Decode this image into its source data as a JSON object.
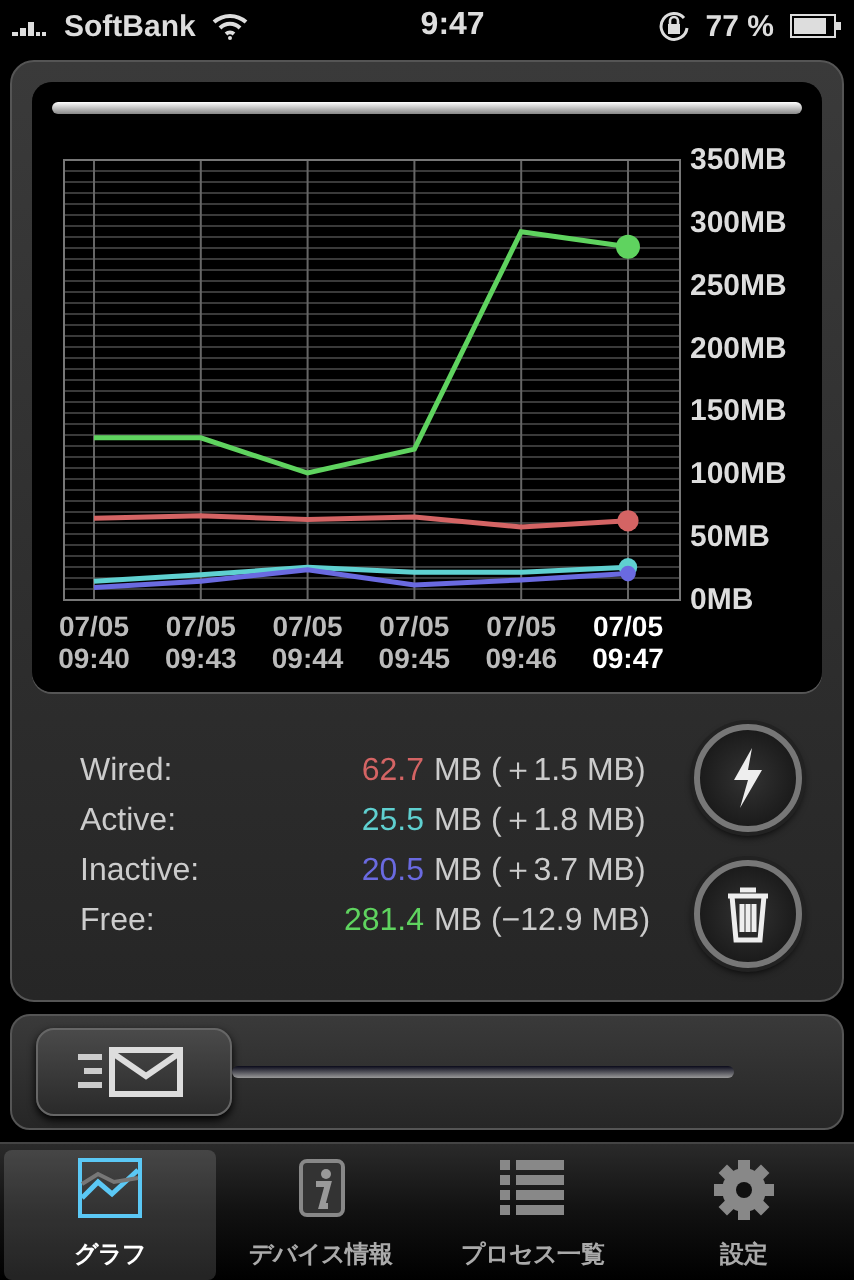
{
  "status_bar": {
    "carrier": "SoftBank",
    "time": "9:47",
    "battery": "77 %"
  },
  "graph": {
    "chart_data": {
      "type": "line",
      "grid": true,
      "categories": [
        "07/05 09:40",
        "07/05 09:43",
        "07/05 09:44",
        "07/05 09:45",
        "07/05 09:46",
        "07/05 09:47"
      ],
      "ylim": [
        0,
        350
      ],
      "yticks": [
        {
          "value": 0,
          "label": "0MB"
        },
        {
          "value": 50,
          "label": "50MB"
        },
        {
          "value": 100,
          "label": "100MB"
        },
        {
          "value": 150,
          "label": "150MB"
        },
        {
          "value": 200,
          "label": "200MB"
        },
        {
          "value": 250,
          "label": "250MB"
        },
        {
          "value": 300,
          "label": "300MB"
        },
        {
          "value": 350,
          "label": "350MB"
        }
      ],
      "series": [
        {
          "color": "#5fd35f",
          "values": [
            129,
            129,
            101,
            120,
            293,
            281
          ]
        },
        {
          "color": "#d46464",
          "values": [
            65,
            67,
            64,
            66,
            58,
            63
          ]
        },
        {
          "color": "#5fd0d0",
          "values": [
            15,
            20,
            26,
            22,
            22,
            26
          ]
        },
        {
          "color": "#6a6ae0",
          "values": [
            10,
            15,
            24,
            12,
            16,
            21
          ]
        }
      ]
    }
  },
  "stats": [
    {
      "label": "Wired:",
      "value": "62.7",
      "color": "#d46464",
      "change": "MB (＋1.5 MB)"
    },
    {
      "label": "Active:",
      "value": "25.5",
      "color": "#5fd0d0",
      "change": "MB (＋1.8 MB)"
    },
    {
      "label": "Inactive:",
      "value": "20.5",
      "color": "#6a6ae0",
      "change": "MB (＋3.7 MB)"
    },
    {
      "label": "Free:",
      "value": "281.4",
      "color": "#5fd35f",
      "change": "MB (−12.9 MB)"
    }
  ],
  "actions": [
    {
      "kind": "boost"
    },
    {
      "kind": "trash"
    }
  ],
  "tabs": [
    {
      "label": "グラフ",
      "selected": true
    },
    {
      "label": "デバイス情報",
      "selected": false
    },
    {
      "label": "プロセス一覧",
      "selected": false
    },
    {
      "label": "設定",
      "selected": false
    }
  ]
}
